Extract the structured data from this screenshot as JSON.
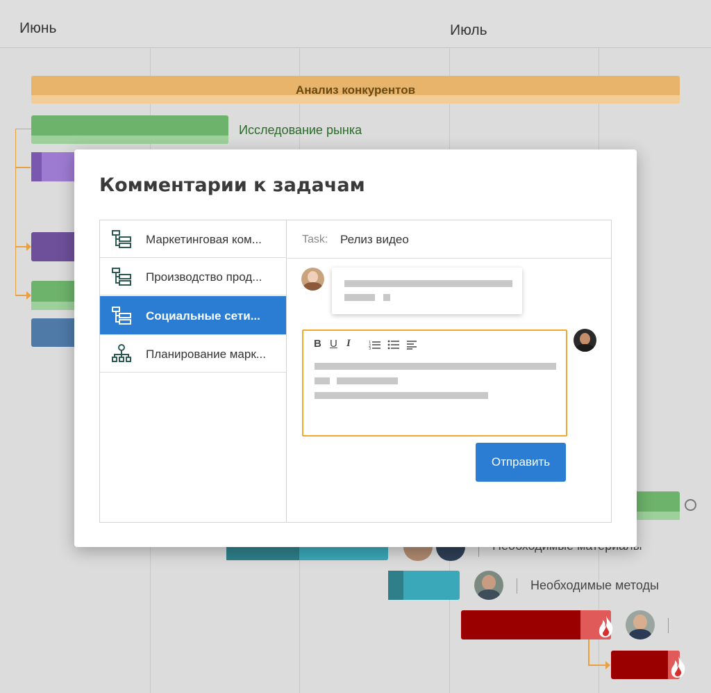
{
  "timeline": {
    "months": [
      "Июнь",
      "Июль"
    ]
  },
  "tasks": {
    "competitor_analysis": "Анализ конкурентов",
    "market_research": "Исследование рынка",
    "required_materials": "Необходимые материалы",
    "required_methods": "Необходимые методы"
  },
  "dialog": {
    "title": "Комментарии к задачам",
    "projects": [
      {
        "label": "Маркетинговая ком...",
        "icon": "hierarchy-list-icon"
      },
      {
        "label": "Производство прод...",
        "icon": "hierarchy-list-icon"
      },
      {
        "label": "Социальные сети...",
        "icon": "hierarchy-list-icon"
      },
      {
        "label": "Планирование марк...",
        "icon": "org-chart-icon"
      }
    ],
    "task_prefix": "Task:",
    "task_name": "Релиз видео",
    "toolbar": {
      "bold": "B",
      "underline": "U",
      "italic": "I"
    },
    "send_label": "Отправить"
  },
  "colors": {
    "accent_blue": "#2a7dd2",
    "orange_bar": "#e8b36b",
    "green_bar": "#6db36b",
    "purple_bar": "#9d7bd1",
    "teal_bar": "#3aa8b8",
    "red_bar": "#9b0000",
    "editor_border": "#f0a830"
  }
}
